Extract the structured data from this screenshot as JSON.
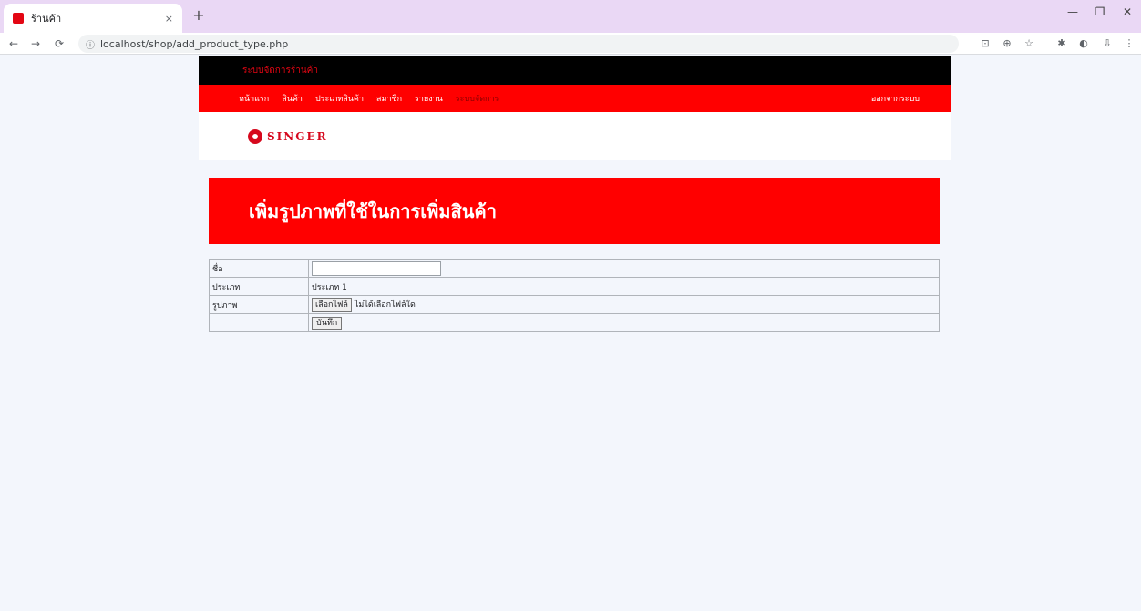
{
  "browser": {
    "tab_title": "ร้านค้า",
    "tab_close": "×",
    "new_tab": "+",
    "url": "localhost/shop/add_product_type.php",
    "win_min": "—",
    "win_max": "❐",
    "win_close": "✕",
    "back": "←",
    "forward": "→",
    "reload": "⟳"
  },
  "site": {
    "topbar_text": "ระบบจัดการร้านค้า",
    "nav": [
      "หน้าแรก",
      "สินค้า",
      "ประเภทสินค้า",
      "สมาชิก",
      "รายงาน",
      "ระบบจัดการ"
    ],
    "nav_active_index": 5,
    "nav_right": "ออกจากระบบ",
    "logo_text": "SINGER"
  },
  "content": {
    "heading": "เพิ่มรูปภาพที่ใช้ในการเพิ่มสินค้า",
    "rows": {
      "name_label": "ชื่อ",
      "type_label": "ประเภท",
      "type_value": "ประเภท 1",
      "image_label": "รูปภาพ",
      "file_button": "เลือกไฟล์",
      "file_status": "ไม่ได้เลือกไฟล์ใด",
      "submit": "บันทึก"
    }
  },
  "colors": {
    "brand_red": "#ff0000",
    "topbar_black": "#000000",
    "page_bg": "#f3f6fc"
  }
}
